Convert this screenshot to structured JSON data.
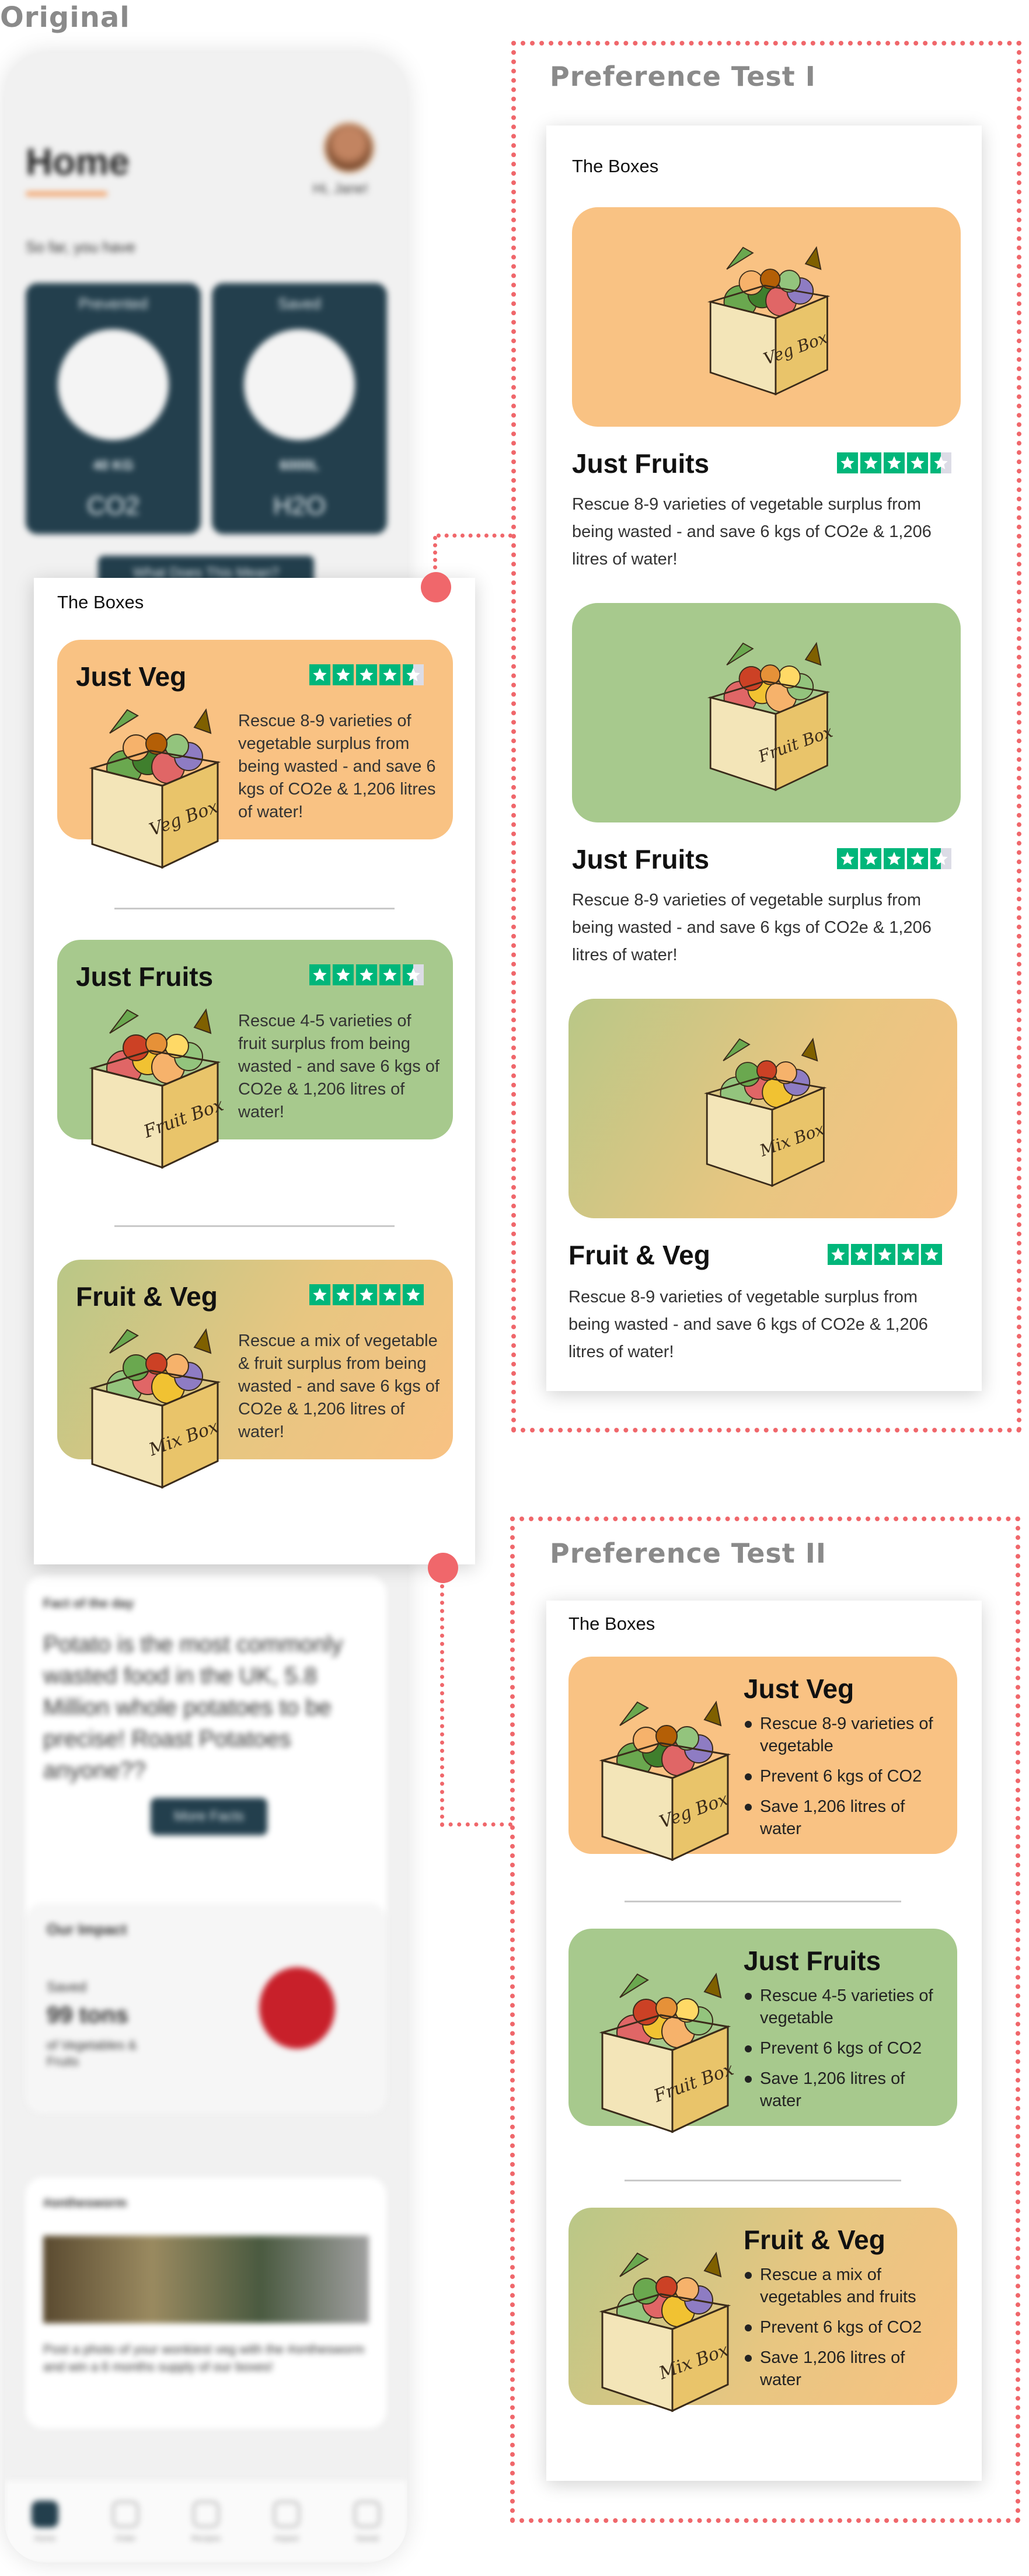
{
  "labels": {
    "original": "Original",
    "test1": "Preference Test I",
    "test2": "Preference Test II"
  },
  "colors": {
    "dotted_frame": "#f0676b",
    "veg_card": "#f9c283",
    "fruit_card": "#a7c98d",
    "star_green": "#00b67a",
    "phone_card": "#233f4d"
  },
  "phone": {
    "title": "Home",
    "greeting": "Hi, Jane!",
    "subtitle": "So far, you have",
    "stat_cards": [
      {
        "caption": "Prevented",
        "value": "40 KG",
        "unit": "CO2",
        "icon": "co2-cloud-icon"
      },
      {
        "caption": "Saved",
        "value": "6000L",
        "unit": "H2O",
        "icon": "water-drop-earth-icon"
      }
    ],
    "what_button": "What Does This Mean?",
    "fact_heading": "Fact of the day",
    "fact_text": "Potato is the most commonly wasted food in the UK, 5.8 Million whole potatoes to be precise! Roast Potatoes anyone??",
    "more_facts": "More Facts",
    "impact_heading": "Our Impact",
    "impact_saved": "Saved",
    "impact_value": "99 tons",
    "impact_sub": "of Vegetables & Fruits",
    "hashtag": "#onthesworm",
    "promo_text": "Post a photo of your wonkiest veg with the #onthesworm and win a 6 months supply of our boxes!",
    "nav": [
      "Home",
      "Order",
      "Recipes",
      "Impact",
      "Saved"
    ]
  },
  "original_panel": {
    "title": "The Boxes",
    "cards": [
      {
        "name": "Just Veg",
        "stars": 4.5,
        "desc": "Rescue 8-9 varieties of vegetable surplus from being wasted - and save 6 kgs of CO2e & 1,206 litres of water!",
        "label": "Veg Box"
      },
      {
        "name": "Just Fruits",
        "stars": 4.5,
        "desc": "Rescue 4-5 varieties of fruit surplus from being wasted - and save 6 kgs of CO2e & 1,206  litres of water!",
        "label": "Fruit Box"
      },
      {
        "name": "Fruit & Veg",
        "stars": 5,
        "desc": "Rescue a mix of vegetable & fruit surplus from being wasted - and save 6 kgs of CO2e & 1,206  litres of water!",
        "label": "Mix Box"
      }
    ]
  },
  "test1_panel": {
    "title": "The Boxes",
    "blocks": [
      {
        "name": "Just Fruits",
        "stars": 4.5,
        "desc": "Rescue 8-9 varieties of vegetable surplus from being wasted - and save 6 kgs of CO2e & 1,206 litres of water!",
        "label": "Veg Box"
      },
      {
        "name": "Just Fruits",
        "stars": 4.5,
        "desc": "Rescue 8-9 varieties of vegetable surplus from being wasted - and save 6 kgs of CO2e & 1,206 litres of water!",
        "label": "Fruit Box"
      },
      {
        "name": "Fruit & Veg",
        "stars": 5,
        "desc": "Rescue 8-9 varieties of vegetable surplus from being wasted - and save 6 kgs of CO2e & 1,206 litres of water!",
        "label": "Mix Box"
      }
    ]
  },
  "test2_panel": {
    "title": "The Boxes",
    "cards": [
      {
        "name": "Just Veg",
        "label": "Veg Box",
        "bullets": [
          "Rescue 8-9 varieties of vegetable",
          "Prevent 6 kgs of CO2",
          "Save 1,206  litres of water"
        ]
      },
      {
        "name": "Just Fruits",
        "label": "Fruit Box",
        "bullets": [
          "Rescue 4-5 varieties of vegetable",
          "Prevent 6 kgs of CO2",
          "Save 1,206  litres of water"
        ]
      },
      {
        "name": "Fruit & Veg",
        "label": "Mix Box",
        "bullets": [
          "Rescue a mix of vegetables and fruits",
          "Prevent 6 kgs of CO2",
          "Save 1,206  litres of water"
        ]
      }
    ]
  }
}
